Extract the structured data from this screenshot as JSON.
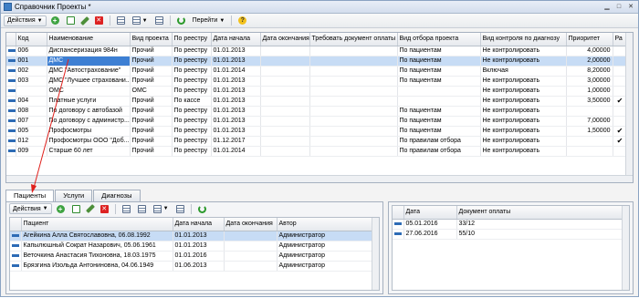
{
  "window": {
    "title": "Справочник Проекты *"
  },
  "toolbar": {
    "actions_label": "Действия",
    "goto_label": "Перейти"
  },
  "top_table": {
    "columns": [
      "Код",
      "Наименование",
      "Вид проекта",
      "По реестру",
      "Дата начала",
      "Дата окончания",
      "Требовать документ оплаты",
      "Вид отбора проекта",
      "Вид контроля по диагнозу",
      "Приоритет",
      "Ра"
    ],
    "rows": [
      [
        "006",
        "Диспансеризация 984н",
        "Прочий",
        "По реестру",
        "01.01.2013",
        "",
        "",
        "По пациентам",
        "Не контролировать",
        "4,00000",
        ""
      ],
      [
        "001",
        "ДМС",
        "Прочий",
        "По реестру",
        "01.01.2013",
        "",
        "",
        "По пациентам",
        "Не контролировать",
        "2,00000",
        ""
      ],
      [
        "002",
        "ДМС \"Автострахование\"",
        "Прочий",
        "По реестру",
        "01.01.2014",
        "",
        "",
        "По пациентам",
        "Включая",
        "8,20000",
        ""
      ],
      [
        "003",
        "ДМС \"Лучшее страховани...",
        "Прочий",
        "По реестру",
        "01.01.2013",
        "",
        "",
        "По пациентам",
        "Не контролировать",
        "3,00000",
        ""
      ],
      [
        "",
        "ОМС",
        "ОМС",
        "По реестру",
        "01.01.2013",
        "",
        "",
        "",
        "Не контролировать",
        "1,00000",
        ""
      ],
      [
        "004",
        "Платные услуги",
        "Прочий",
        "По кассе",
        "01.01.2013",
        "",
        "",
        "",
        "Не контролировать",
        "3,50000",
        "✔"
      ],
      [
        "008",
        "По договору с автобазой",
        "Прочий",
        "По реестру",
        "01.01.2013",
        "",
        "",
        "По пациентам",
        "Не контролировать",
        "",
        ""
      ],
      [
        "007",
        "По договору с администр...",
        "Прочий",
        "По реестру",
        "01.01.2013",
        "",
        "",
        "По пациентам",
        "Не контролировать",
        "7,00000",
        ""
      ],
      [
        "005",
        "Профосмотры",
        "Прочий",
        "По реестру",
        "01.01.2013",
        "",
        "",
        "По пациентам",
        "Не контролировать",
        "1,50000",
        "✔"
      ],
      [
        "012",
        "Профосмотры ООО \"Доб...",
        "Прочий",
        "По реестру",
        "01.12.2017",
        "",
        "",
        "По правилам отбора",
        "Не контролировать",
        "",
        "✔"
      ],
      [
        "009",
        "Старше 60 лет",
        "Прочий",
        "По реестру",
        "01.01.2014",
        "",
        "",
        "По правилам отбора",
        "Не контролировать",
        "",
        ""
      ]
    ]
  },
  "tabs": [
    "Пациенты",
    "Услуги",
    "Диагнозы"
  ],
  "patients_table": {
    "actions_label": "Действия",
    "columns": [
      "Пациент",
      "Дата начала",
      "Дата окончания",
      "Автор"
    ],
    "rows": [
      [
        "Агейкина Алла Святославовна, 06.08.1992",
        "01.01.2013",
        "",
        "Администратор"
      ],
      [
        "Капылюшный Сократ Назарович, 05.06.1961",
        "01.01.2013",
        "",
        "Администратор"
      ],
      [
        "Веточкина Анастасия Тихоновна, 18.03.1975",
        "01.01.2016",
        "",
        "Администратор"
      ],
      [
        "Брязгина Изольда Антониновна, 04.06.1949",
        "01.06.2013",
        "",
        "Администратор"
      ]
    ]
  },
  "payments_table": {
    "columns": [
      "Дата",
      "Документ оплаты"
    ],
    "rows": [
      [
        "05.01.2016",
        "33/12"
      ],
      [
        "27.06.2016",
        "55/10"
      ]
    ]
  },
  "colors": {
    "selection": "#3d7fd3",
    "row_highlight": "#c7dcf5",
    "arrow": "#e0201c"
  }
}
